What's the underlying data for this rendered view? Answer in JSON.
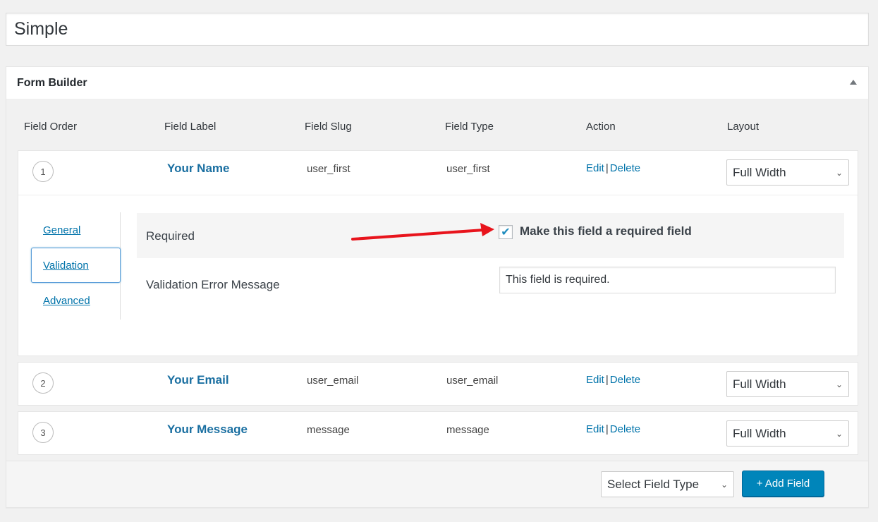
{
  "title": {
    "value": "Simple"
  },
  "metabox": {
    "title": "Form Builder"
  },
  "columns": [
    "Field Order",
    "Field Label",
    "Field Slug",
    "Field Type",
    "Action",
    "Layout"
  ],
  "action_labels": {
    "edit": "Edit",
    "separator": "|",
    "delete": "Delete"
  },
  "fields": [
    {
      "order": "1",
      "label": "Your Name",
      "slug": "user_first",
      "type": "user_first",
      "layout": "Full Width"
    },
    {
      "order": "2",
      "label": "Your Email",
      "slug": "user_email",
      "type": "user_email",
      "layout": "Full Width"
    },
    {
      "order": "3",
      "label": "Your Message",
      "slug": "message",
      "type": "message",
      "layout": "Full Width"
    }
  ],
  "settings": {
    "tabs": [
      "General",
      "Validation",
      "Advanced"
    ],
    "active_tab": "Validation",
    "required_label": "Required",
    "required_checkbox_text": "Make this field a required field",
    "required_checked": true,
    "error_label": "Validation Error Message",
    "error_value": "This field is required."
  },
  "footer": {
    "select_placeholder": "Select Field Type",
    "add_button": "+ Add Field"
  },
  "colors": {
    "accent": "#0073aa",
    "button": "#0085ba",
    "arrow": "#e8141c"
  }
}
